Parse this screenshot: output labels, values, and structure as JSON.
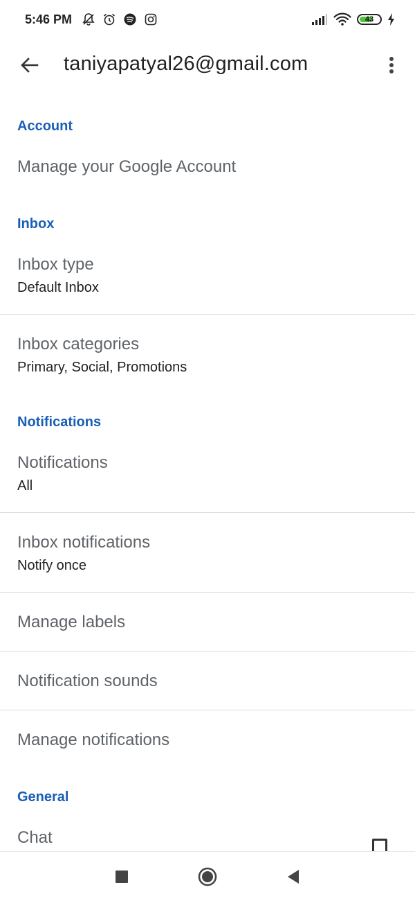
{
  "status_bar": {
    "time": "5:46 PM",
    "left_icons": [
      "mute-bell-icon",
      "alarm-icon",
      "spotify-icon",
      "instagram-icon"
    ],
    "right_icons": [
      "signal-icon",
      "wifi-icon",
      "battery-icon",
      "charging-icon"
    ],
    "battery_level": "43",
    "battery_color": "#52c33d"
  },
  "app_bar": {
    "back_icon": "arrow-back-icon",
    "title": "taniyapatyal26@gmail.com",
    "menu_icon": "more-vert-icon"
  },
  "accent_color": "#1a5fb4",
  "sections": {
    "account": {
      "header": "Account",
      "items": [
        {
          "title": "Manage your Google Account"
        }
      ]
    },
    "inbox": {
      "header": "Inbox",
      "items": [
        {
          "title": "Inbox type",
          "subtitle": "Default Inbox"
        },
        {
          "title": "Inbox categories",
          "subtitle": "Primary, Social, Promotions"
        }
      ]
    },
    "notifications": {
      "header": "Notifications",
      "items": [
        {
          "title": "Notifications",
          "subtitle": "All"
        },
        {
          "title": "Inbox notifications",
          "subtitle": "Notify once"
        },
        {
          "title": "Manage labels"
        },
        {
          "title": "Notification sounds"
        },
        {
          "title": "Manage notifications"
        }
      ]
    },
    "general": {
      "header": "General",
      "items": [
        {
          "title": "Chat",
          "checked": false
        }
      ]
    }
  },
  "nav_bar": {
    "buttons": [
      "recents-square-icon",
      "home-circle-icon",
      "back-triangle-icon"
    ]
  }
}
